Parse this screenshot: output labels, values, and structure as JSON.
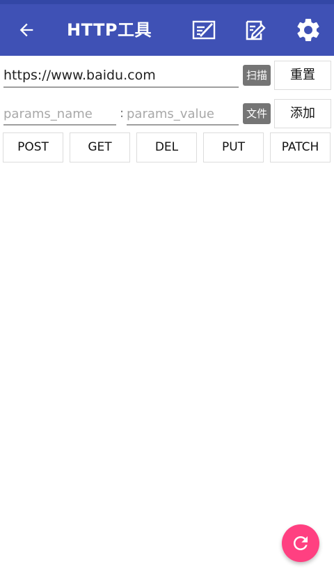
{
  "app_bar": {
    "title": "HTTP工具",
    "icons": {
      "back": "arrow-left-icon",
      "one": "note-pen-icon",
      "two": "edit-document-icon",
      "three": "gear-icon"
    }
  },
  "request": {
    "url": "https://www.baidu.com",
    "scan_label": "扫描",
    "reset_label": "重置",
    "param_name_placeholder": "params_name",
    "param_value_placeholder": "params_value",
    "separator": ":",
    "file_label": "文件",
    "add_label": "添加"
  },
  "methods": [
    "POST",
    "GET",
    "DEL",
    "PUT",
    "PATCH"
  ],
  "fab": {
    "icon": "refresh-icon",
    "color": "#ff4081"
  },
  "colors": {
    "primary": "#3f51b5",
    "primary_dark": "#3347a6",
    "tag_bg": "#757575"
  }
}
